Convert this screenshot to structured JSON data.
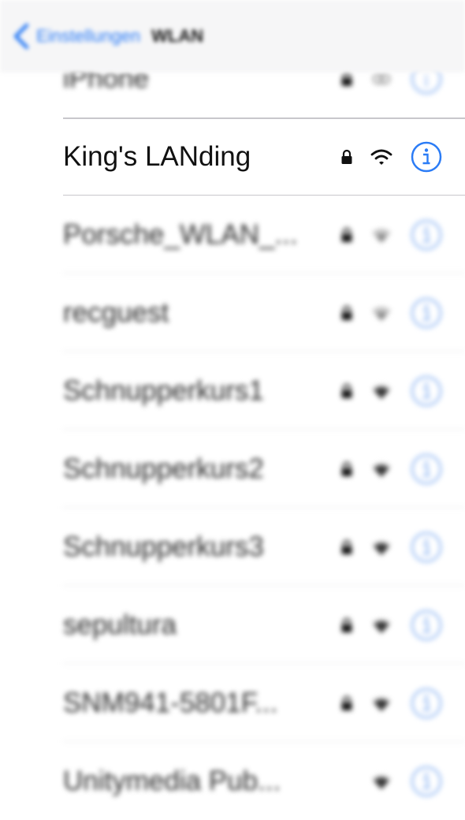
{
  "navbar": {
    "back_label": "Einstellungen",
    "title": "WLAN",
    "accent": "#2b7cf6"
  },
  "networks": [
    {
      "name": "iPhone",
      "locked": true,
      "signal": "hotspot-link"
    },
    {
      "name": "King's LANding",
      "locked": true,
      "signal": "full"
    },
    {
      "name": "Porsche_WLAN_...",
      "locked": true,
      "signal": "weak"
    },
    {
      "name": "recguest",
      "locked": true,
      "signal": "weak"
    },
    {
      "name": "Schnupperkurs1",
      "locked": true,
      "signal": "medium"
    },
    {
      "name": "Schnupperkurs2",
      "locked": true,
      "signal": "medium"
    },
    {
      "name": "Schnupperkurs3",
      "locked": true,
      "signal": "medium"
    },
    {
      "name": "sepultura",
      "locked": true,
      "signal": "medium"
    },
    {
      "name": "SNM941-5801F...",
      "locked": true,
      "signal": "medium"
    },
    {
      "name": "Unitymedia Pub...",
      "locked": false,
      "signal": "medium"
    }
  ],
  "icons": {
    "lock": "lock-icon",
    "wifi": "wifi-icon",
    "info": "info-icon",
    "back": "chevron-left-icon"
  }
}
